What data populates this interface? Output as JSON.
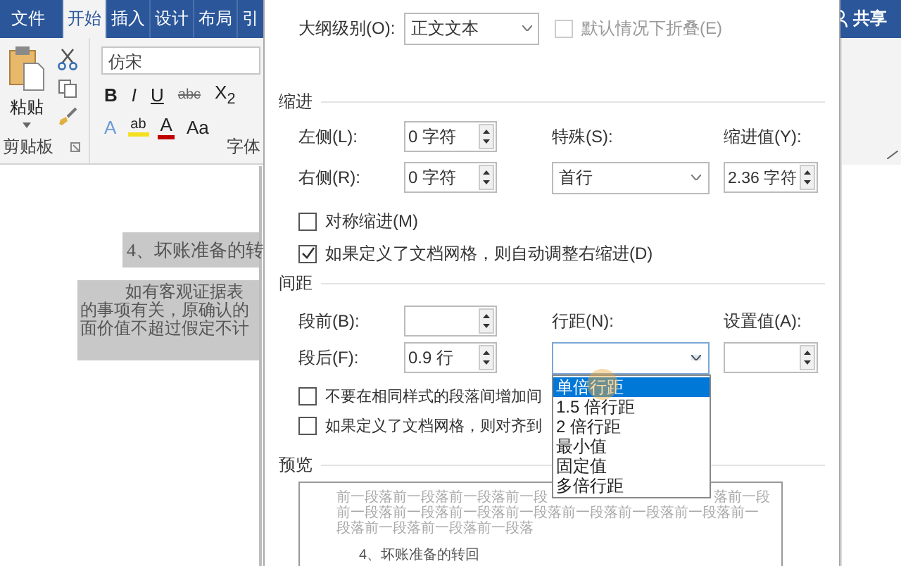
{
  "ribbon": {
    "tabs": [
      {
        "label": "文件",
        "selected": false
      },
      {
        "label": "开始",
        "selected": true
      },
      {
        "label": "插入",
        "selected": false
      },
      {
        "label": "设计",
        "selected": false
      },
      {
        "label": "布局",
        "selected": false
      },
      {
        "label": "引",
        "selected": false
      }
    ],
    "share": "共享",
    "clipboard": {
      "paste": "粘贴",
      "group": "剪贴板"
    },
    "font": {
      "name": "仿宋",
      "group": "字体",
      "row1": [
        "B",
        "I",
        "U",
        "abc",
        "X$_{2}$"
      ],
      "row2": [
        "A",
        "ab",
        "A",
        "Aa"
      ]
    }
  },
  "document": {
    "heading": "4、坏账准备的转",
    "lines": [
      "如有客观证据表",
      "的事项有关，原确认的",
      "面价值不超过假定不计"
    ]
  },
  "dialog": {
    "outline_level": {
      "label": "大纲级别(O):",
      "value": "正文文本"
    },
    "collapse": {
      "label": "默认情况下折叠(E)",
      "checked": false,
      "disabled": true
    },
    "indent": {
      "title": "缩进",
      "left": {
        "label": "左侧(L):",
        "value": "0 字符"
      },
      "right": {
        "label": "右侧(R):",
        "value": "0 字符"
      },
      "special": {
        "label": "特殊(S):",
        "value": "首行"
      },
      "by": {
        "label": "缩进值(Y):",
        "value": "2.36 字符"
      },
      "mirror": {
        "label": "对称缩进(M)",
        "checked": false
      },
      "auto_adjust": {
        "label": "如果定义了文档网格，则自动调整右缩进(D)",
        "checked": true
      }
    },
    "spacing": {
      "title": "间距",
      "before": {
        "label": "段前(B):"
      },
      "after": {
        "label": "段后(F):",
        "value": "0.9 行"
      },
      "line_spacing": {
        "label": "行距(N):",
        "options": [
          {
            "label": "单倍行距",
            "selected": true
          },
          {
            "label": "1.5 倍行距",
            "selected": false
          },
          {
            "label": "2 倍行距",
            "selected": false
          },
          {
            "label": "最小值",
            "selected": false
          },
          {
            "label": "固定值",
            "selected": false
          },
          {
            "label": "多倍行距",
            "selected": false
          }
        ]
      },
      "at": {
        "label": "设置值(A):"
      },
      "dont_add": {
        "label": "不要在相同样式的段落间增加间",
        "checked": false
      },
      "snap": {
        "label": "如果定义了文档网格，则对齐到",
        "checked": false
      }
    },
    "preview": {
      "title": "预览",
      "first_line": [
        "前一段落前一段落前一段落前一段",
        "落前一段"
      ],
      "lines": [
        "前一段落前一段落前一段落前一段落前一段落前一段落前一段落前一",
        "段落前一段落前一段落前一段落"
      ],
      "heading": "4、坏账准备的转回"
    }
  }
}
